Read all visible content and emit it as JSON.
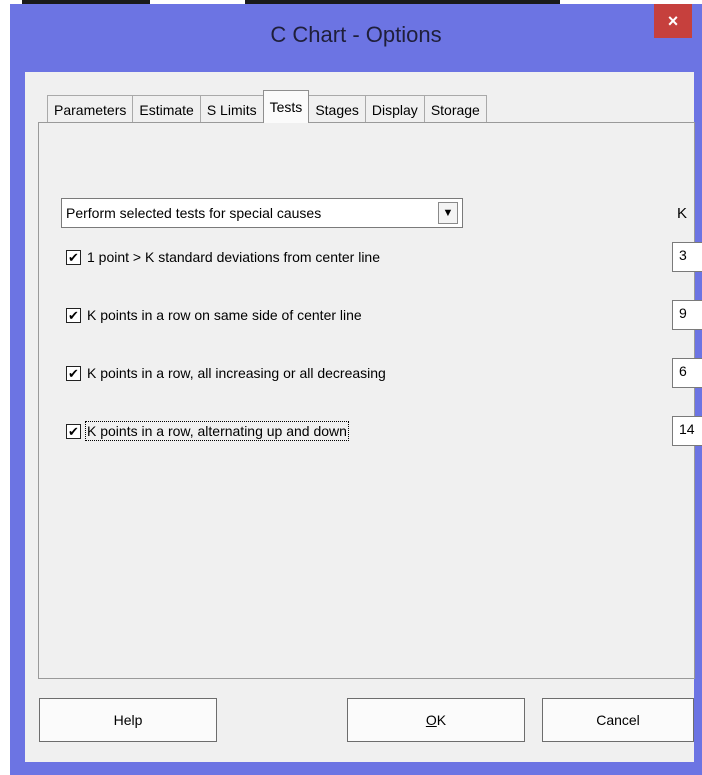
{
  "window": {
    "title": "C Chart - Options",
    "close_glyph": "×"
  },
  "tabs": [
    {
      "label": "Parameters",
      "active": false
    },
    {
      "label": "Estimate",
      "active": false
    },
    {
      "label": "S Limits",
      "active": false
    },
    {
      "label": "Tests",
      "active": true
    },
    {
      "label": "Stages",
      "active": false
    },
    {
      "label": "Display",
      "active": false
    },
    {
      "label": "Storage",
      "active": false
    }
  ],
  "tests": {
    "mode": "Perform selected tests for special causes",
    "k_header": "K",
    "items": [
      {
        "label": "1 point > K standard deviations from center line",
        "checked": true,
        "k": "3"
      },
      {
        "label": "K points in a row on same side of center line",
        "checked": true,
        "k": "9"
      },
      {
        "label": "K points in a row, all increasing or all decreasing",
        "checked": true,
        "k": "6"
      },
      {
        "label": "K points in a row, alternating up and down",
        "checked": true,
        "k": "14"
      }
    ]
  },
  "buttons": {
    "help": "Help",
    "ok_mnemonic": "O",
    "ok_rest": "K",
    "cancel": "Cancel"
  },
  "colors": {
    "titlebar": "#6c74e3",
    "close": "#c6403d",
    "dialog_bg": "#f0f0f0"
  },
  "icons": {
    "checkmark": "✔",
    "dropdown": "▼"
  }
}
